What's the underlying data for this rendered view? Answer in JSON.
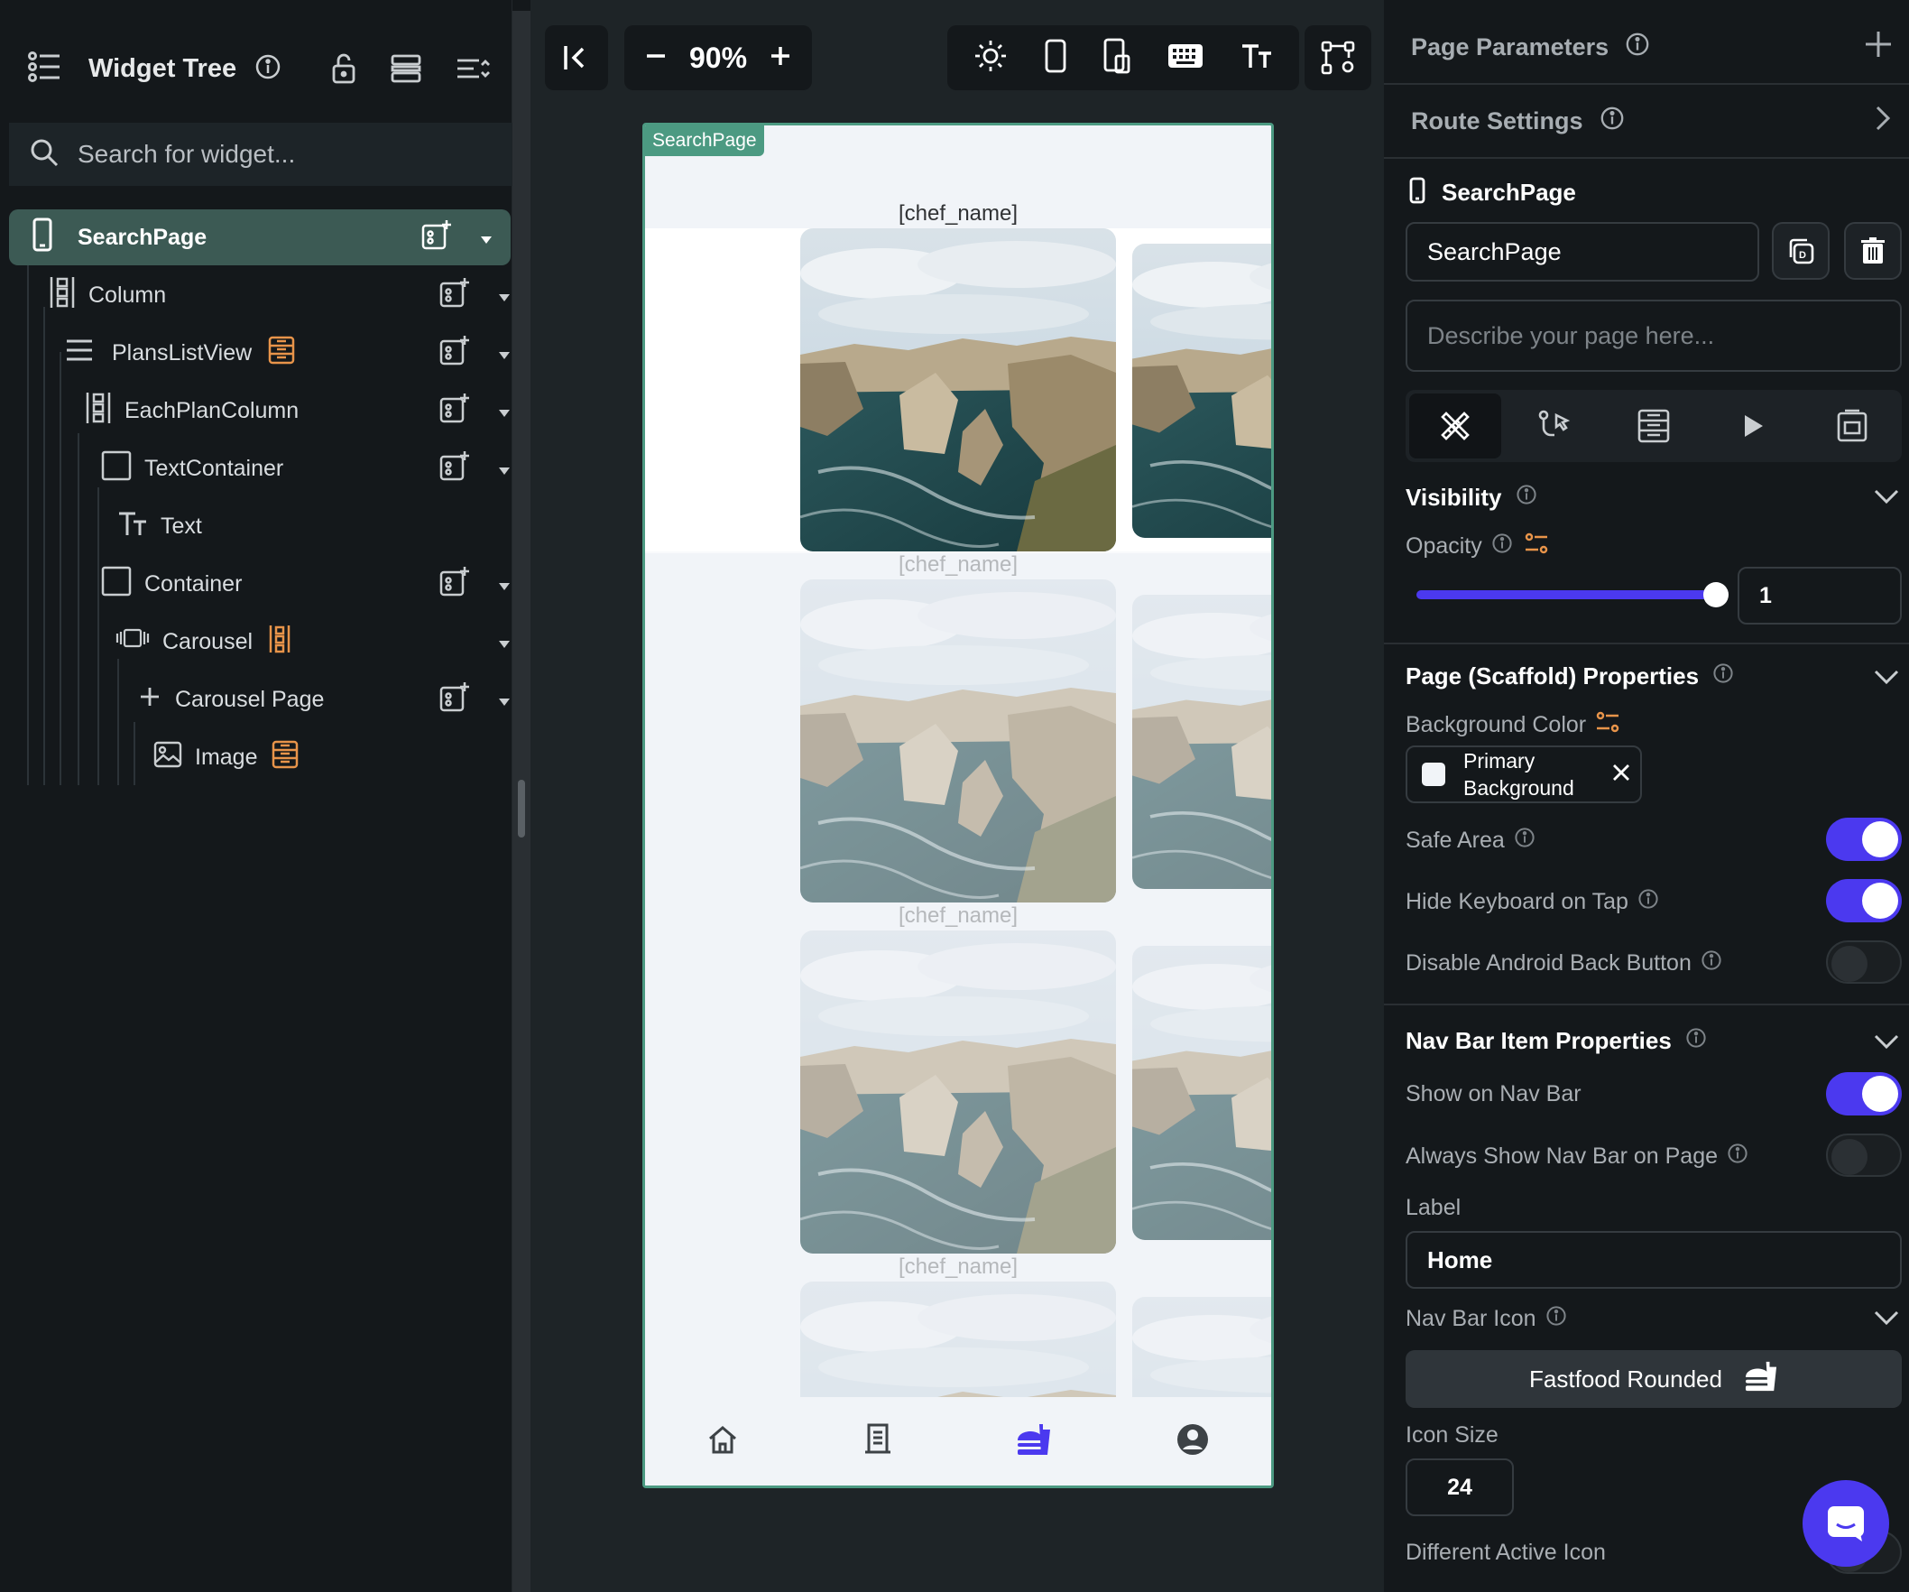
{
  "left_panel": {
    "title": "Widget Tree",
    "search_placeholder": "Search for widget...",
    "tree": [
      {
        "label": "SearchPage"
      },
      {
        "label": "Column"
      },
      {
        "label": "PlansListView"
      },
      {
        "label": "EachPlanColumn"
      },
      {
        "label": "TextContainer"
      },
      {
        "label": "Text"
      },
      {
        "label": "Container"
      },
      {
        "label": "Carousel"
      },
      {
        "label": "Carousel Page"
      },
      {
        "label": "Image"
      }
    ]
  },
  "toolbar": {
    "zoom": "90%"
  },
  "canvas": {
    "page_tag": "SearchPage",
    "item_text": "[chef_name]",
    "nav_items": [
      "home-icon",
      "receipt-icon",
      "fastfood-icon",
      "account-circle-icon"
    ],
    "active_nav_color": "#4b39ef"
  },
  "right_panel": {
    "page_parameters": "Page Parameters",
    "route_settings": "Route Settings",
    "page_header": "SearchPage",
    "page_name_value": "SearchPage",
    "description_placeholder": "Describe your page here...",
    "visibility": {
      "title": "Visibility",
      "opacity_label": "Opacity",
      "opacity_value": "1",
      "opacity_level": 1.0
    },
    "scaffold": {
      "title": "Page (Scaffold) Properties",
      "bg_color_label": "Background Color",
      "bg_color_value": "Primary Background",
      "bg_color_hex": "#f1f4f8",
      "safe_area": "Safe Area",
      "hide_keyboard": "Hide Keyboard on Tap",
      "disable_back": "Disable Android Back Button"
    },
    "navbar": {
      "title": "Nav Bar Item Properties",
      "show_on_nav": "Show on Nav Bar",
      "always_show": "Always Show Nav Bar on Page",
      "label_label": "Label",
      "label_value": "Home",
      "icon_label": "Nav Bar Icon",
      "icon_value": "Fastfood Rounded",
      "icon_size_label": "Icon Size",
      "icon_size_value": "24",
      "different_active": "Different Active Icon"
    },
    "accent_color": "#4b39ef"
  }
}
